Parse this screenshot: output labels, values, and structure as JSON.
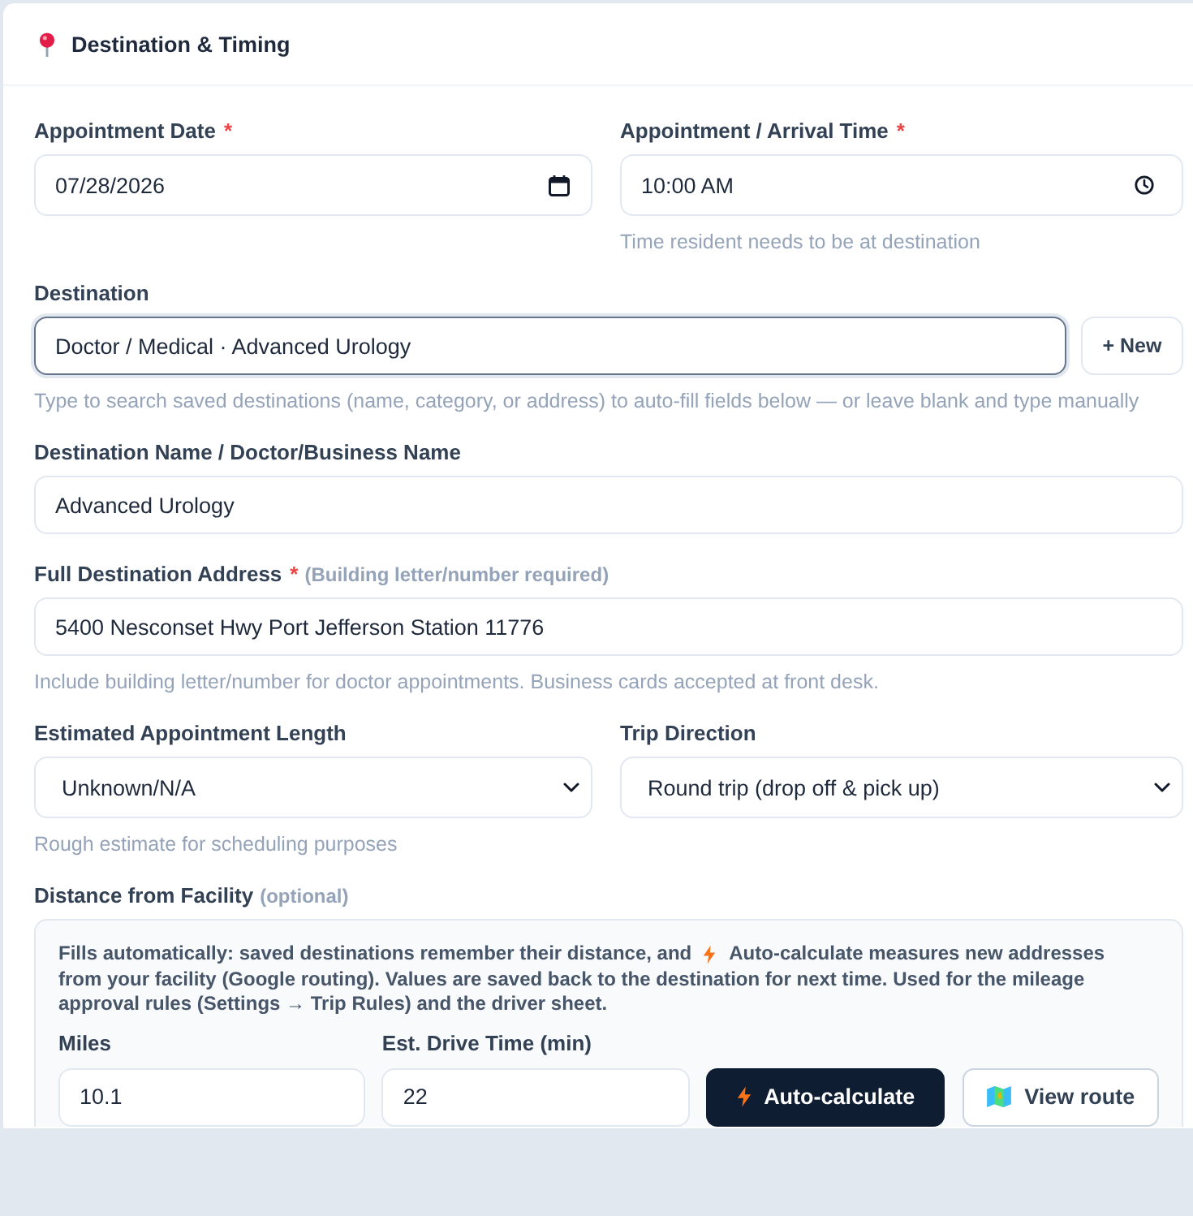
{
  "section": {
    "title": "Destination & Timing"
  },
  "schedule": [
    {
      "kind": "date",
      "label": "Appointment Date",
      "required_mark": "*",
      "value": "07/28/2026"
    },
    {
      "kind": "time",
      "label": "Appointment / Arrival Time",
      "required_mark": "*",
      "value": "10:00 AM",
      "help": "Time resident needs to be at destination"
    }
  ],
  "destination": {
    "label": "Destination",
    "value": "Doctor / Medical · Advanced Urology",
    "focused": true,
    "new_button": "+ New",
    "help": "Type to search saved destinations (name, category, or address) to auto-fill fields below — or leave blank and type manually"
  },
  "destination_name": {
    "label": "Destination Name / Doctor/Business Name",
    "value": "Advanced Urology"
  },
  "address": {
    "label": "Full Destination Address",
    "required_mark": "*",
    "note": "(Building letter/number required)",
    "value": "5400 Nesconset Hwy Port Jefferson Station 11776",
    "help": "Include building letter/number for doctor appointments. Business cards accepted at front desk."
  },
  "trip": [
    {
      "label": "Estimated Appointment Length",
      "value": "Unknown/N/A",
      "help": "Rough estimate for scheduling purposes"
    },
    {
      "label": "Trip Direction",
      "value": "Round trip (drop off & pick up)"
    }
  ],
  "distance": {
    "label": "Distance from Facility",
    "note": "(optional)",
    "info": [
      "Fills automatically: saved destinations remember their distance, and",
      "Auto-calculate measures new addresses",
      "from your facility (Google routing). Values are saved back to the destination for next time. Used for the mileage approval rules (Settings → Trip Rules) and the driver sheet."
    ],
    "fields": [
      {
        "label": "Miles",
        "value": "10.1"
      },
      {
        "label": "Est. Drive Time (min)",
        "value": "22"
      }
    ],
    "auto_button": "Auto-calculate",
    "route_button": "View route"
  }
}
